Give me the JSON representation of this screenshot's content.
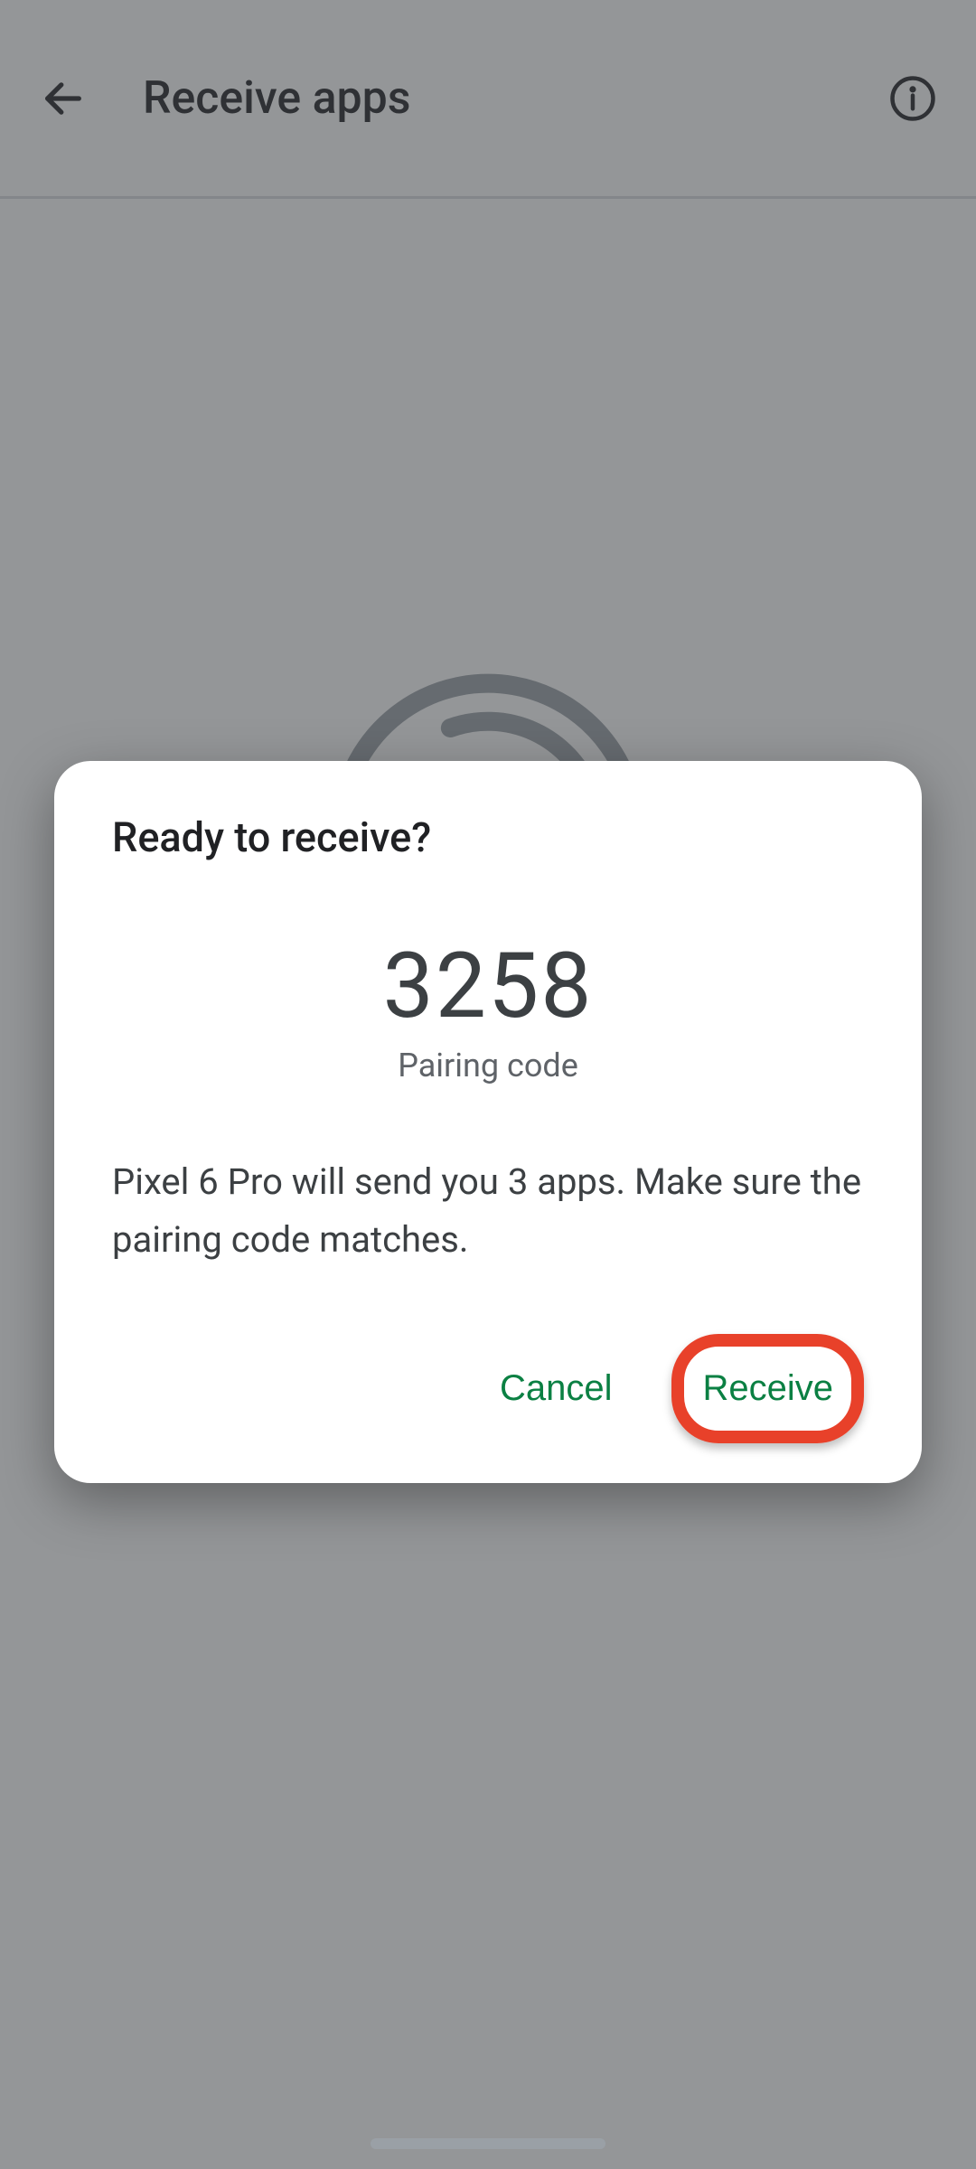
{
  "appbar": {
    "title": "Receive apps"
  },
  "dialog": {
    "title": "Ready to receive?",
    "pairing_code": "3258",
    "pairing_label": "Pairing code",
    "body": "Pixel 6 Pro will send you 3 apps. Make sure the pairing code matches.",
    "cancel_label": "Cancel",
    "receive_label": "Receive"
  },
  "colors": {
    "accent_green": "#0b8043",
    "highlight_red": "#e8412a"
  }
}
